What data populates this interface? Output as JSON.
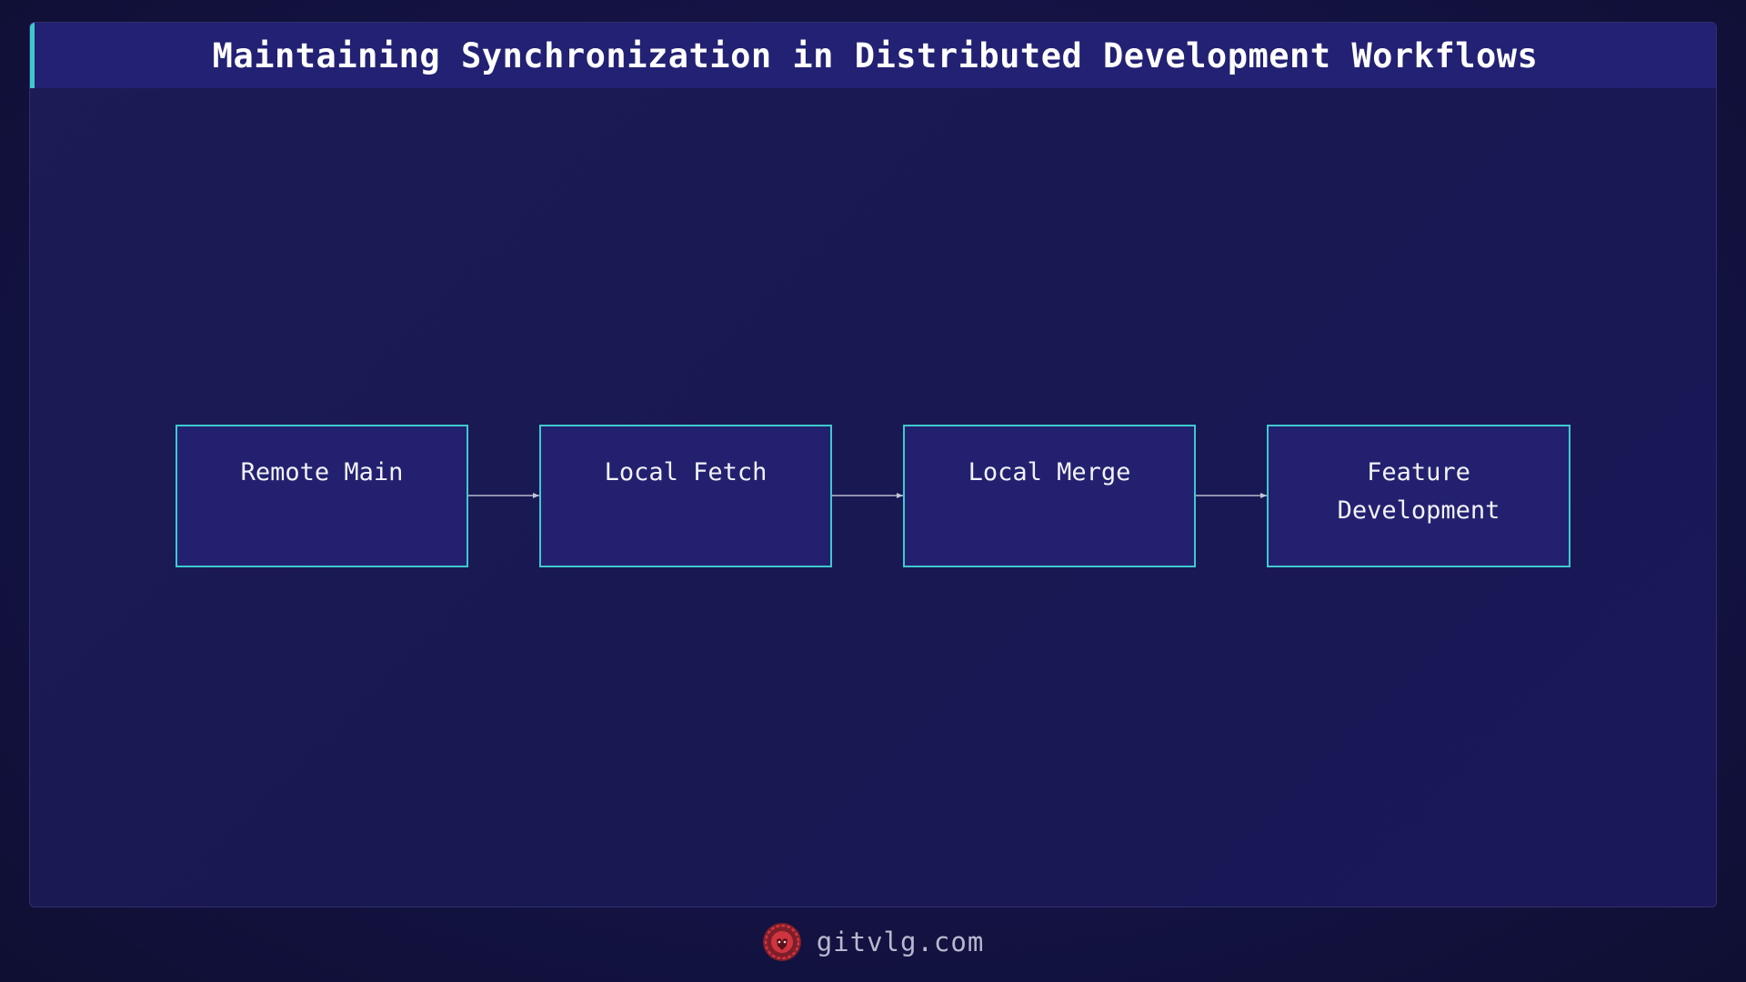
{
  "title": "Maintaining Synchronization in Distributed Development Workflows",
  "diagram": {
    "nodes": [
      {
        "id": "remote-main",
        "label": "Remote Main"
      },
      {
        "id": "local-fetch",
        "label": "Local Fetch"
      },
      {
        "id": "local-merge",
        "label": "Local Merge"
      },
      {
        "id": "feature-development",
        "label": "Feature\nDevelopment"
      }
    ],
    "edges": [
      {
        "from": "remote-main",
        "to": "local-fetch"
      },
      {
        "from": "local-fetch",
        "to": "local-merge"
      },
      {
        "from": "local-merge",
        "to": "feature-development"
      }
    ]
  },
  "footer": {
    "site": "gitvlg.com",
    "logo_icon": "lion-head-icon"
  },
  "colors": {
    "background": "#141345",
    "title_bar": "#232173",
    "accent": "#3fc9cf",
    "node_fill": "#23216f",
    "edge": "#b8b8cf",
    "logo": "#d0353f"
  }
}
